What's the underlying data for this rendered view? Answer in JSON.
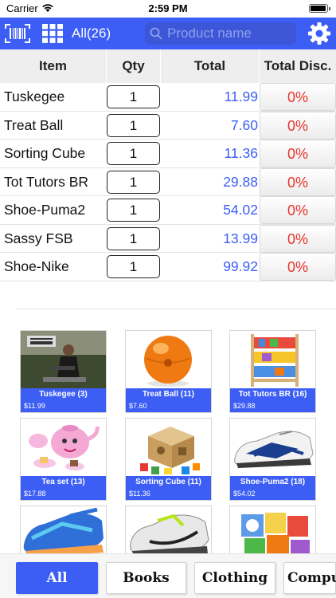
{
  "status_bar": {
    "carrier": "Carrier",
    "time": "2:59 PM"
  },
  "toolbar": {
    "category_count": "All(26)",
    "search_placeholder": "Product name"
  },
  "table": {
    "headers": {
      "item": "Item",
      "qty": "Qty",
      "total": "Total",
      "disc": "Total Disc."
    },
    "rows": [
      {
        "name": "Tuskegee",
        "qty": "1",
        "total": "11.99",
        "disc": "0%"
      },
      {
        "name": "Treat Ball",
        "qty": "1",
        "total": "7.60",
        "disc": "0%"
      },
      {
        "name": "Sorting Cube",
        "qty": "1",
        "total": "11.36",
        "disc": "0%"
      },
      {
        "name": "Tot Tutors BR",
        "qty": "1",
        "total": "29.88",
        "disc": "0%"
      },
      {
        "name": "Shoe-Puma2",
        "qty": "1",
        "total": "54.02",
        "disc": "0%"
      },
      {
        "name": "Sassy FSB",
        "qty": "1",
        "total": "13.99",
        "disc": "0%"
      },
      {
        "name": "Shoe-Nike",
        "qty": "1",
        "total": "99.92",
        "disc": "0%"
      }
    ]
  },
  "products": [
    {
      "name": "Tuskegee",
      "count": "(3)",
      "price": "$11.99"
    },
    {
      "name": "Treat Ball",
      "count": "(11)",
      "price": "$7.60"
    },
    {
      "name": "Tot Tutors BR",
      "count": "(16)",
      "price": "$29.88"
    },
    {
      "name": "Tea set",
      "count": "(13)",
      "price": "$17.88"
    },
    {
      "name": "Sorting Cube",
      "count": "(11)",
      "price": "$11.36"
    },
    {
      "name": "Shoe-Puma2",
      "count": "(18)",
      "price": "$54.02"
    },
    {
      "name": "",
      "count": "",
      "price": ""
    },
    {
      "name": "",
      "count": "",
      "price": ""
    },
    {
      "name": "",
      "count": "",
      "price": ""
    }
  ],
  "tabs": [
    {
      "label": "All"
    },
    {
      "label": "Books"
    },
    {
      "label": "Clothing"
    },
    {
      "label": "Compu"
    }
  ],
  "colors": {
    "accent": "#3c5ef5",
    "discount": "#e8352b",
    "total": "#3c5ef5"
  }
}
